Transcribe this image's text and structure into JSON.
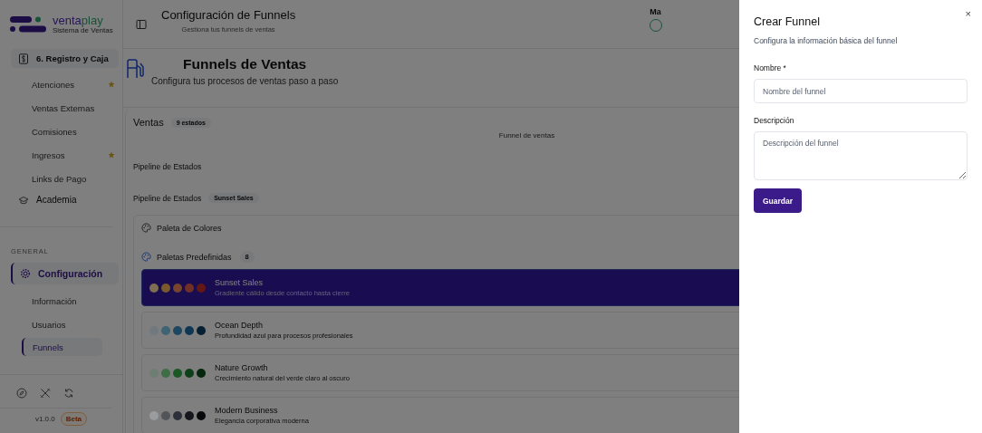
{
  "brand": {
    "name_part1": "venta",
    "name_part2": "play",
    "tagline": "Sistema de Ventas"
  },
  "header": {
    "title": "Configuración de Funnels",
    "subtitle": "Gestiona tus funnels de ventas",
    "user_partial": "Ma"
  },
  "sidebar": {
    "groups": [
      {
        "label": "6. Registro y Caja",
        "selected": false,
        "children": [
          {
            "label": "Atenciones",
            "starred": true,
            "selected": false
          },
          {
            "label": "Ventas Externas",
            "starred": false,
            "selected": false
          },
          {
            "label": "Comisiones",
            "starred": false,
            "selected": false
          },
          {
            "label": "Ingresos",
            "starred": true,
            "selected": false
          },
          {
            "label": "Links de Pago",
            "starred": false,
            "selected": false
          }
        ]
      },
      {
        "label": "Academia",
        "selected": false
      }
    ],
    "section_label": "GENERAL",
    "general": [
      {
        "label": "Configuración",
        "selected": true,
        "children": [
          {
            "label": "Información",
            "starred": false,
            "selected": false
          },
          {
            "label": "Usuarios",
            "starred": false,
            "selected": false
          },
          {
            "label": "Funnels",
            "starred": false,
            "selected": true
          }
        ]
      }
    ],
    "version": "v1.0.0",
    "version_badge": "Beta"
  },
  "page": {
    "title": "Funnels de Ventas",
    "subtitle": "Configura tus procesos de ventas paso a paso"
  },
  "funnel": {
    "name": "Ventas",
    "badge": "9 estados",
    "caption": "Funnel de ventas",
    "pipeline_label": "Pipeline de Estados",
    "pipeline_label_2": "Pipeline de Estados",
    "pipeline_badge": "Sunset Sales",
    "palette_panel": {
      "title": "Paleta de Colores",
      "predefined_label": "Paletas Predefinidas",
      "predefined_count": "8",
      "palettes": [
        {
          "name": "Sunset Sales",
          "description": "Gradiente cálido desde contacto hasta cierre",
          "selected": true,
          "swatches": [
            {
              "color": "#7e6e52"
            },
            {
              "color": "#7a592d"
            },
            {
              "color": "#77452d"
            },
            {
              "color": "#703025"
            },
            {
              "color": "#641816"
            }
          ]
        },
        {
          "name": "Ocean Depth",
          "description": "Profundidad azul para procesos profesionales",
          "selected": false,
          "swatches": [
            {
              "color": "#70797f"
            },
            {
              "color": "#3d6375"
            },
            {
              "color": "#1d4761"
            },
            {
              "color": "#0f3754"
            },
            {
              "color": "#071f33"
            }
          ]
        },
        {
          "name": "Nature Growth",
          "description": "Crecimiento natural del verde claro al oscuro",
          "selected": false,
          "swatches": [
            {
              "color": "#6e7e73"
            },
            {
              "color": "#3e6e46"
            },
            {
              "color": "#1a5825"
            },
            {
              "color": "#0e4019"
            },
            {
              "color": "#07260e"
            }
          ]
        },
        {
          "name": "Modern Business",
          "description": "Elegancia corporativa moderna",
          "selected": false,
          "swatches": [
            {
              "color": "#9a9ca0"
            },
            {
              "color": "#515459"
            },
            {
              "color": "#2d3038"
            },
            {
              "color": "#15171d"
            },
            {
              "color": "#08090c"
            }
          ]
        }
      ]
    }
  },
  "drawer": {
    "title": "Crear Funnel",
    "subtitle": "Configura la información básica del funnel",
    "close": "×",
    "fields": [
      {
        "kind": "input",
        "label": "Nombre *",
        "placeholder": "Nombre del funnel"
      },
      {
        "kind": "textarea",
        "label": "Descripción",
        "placeholder": "Descripción del funnel"
      }
    ],
    "submit": "Guardar"
  }
}
